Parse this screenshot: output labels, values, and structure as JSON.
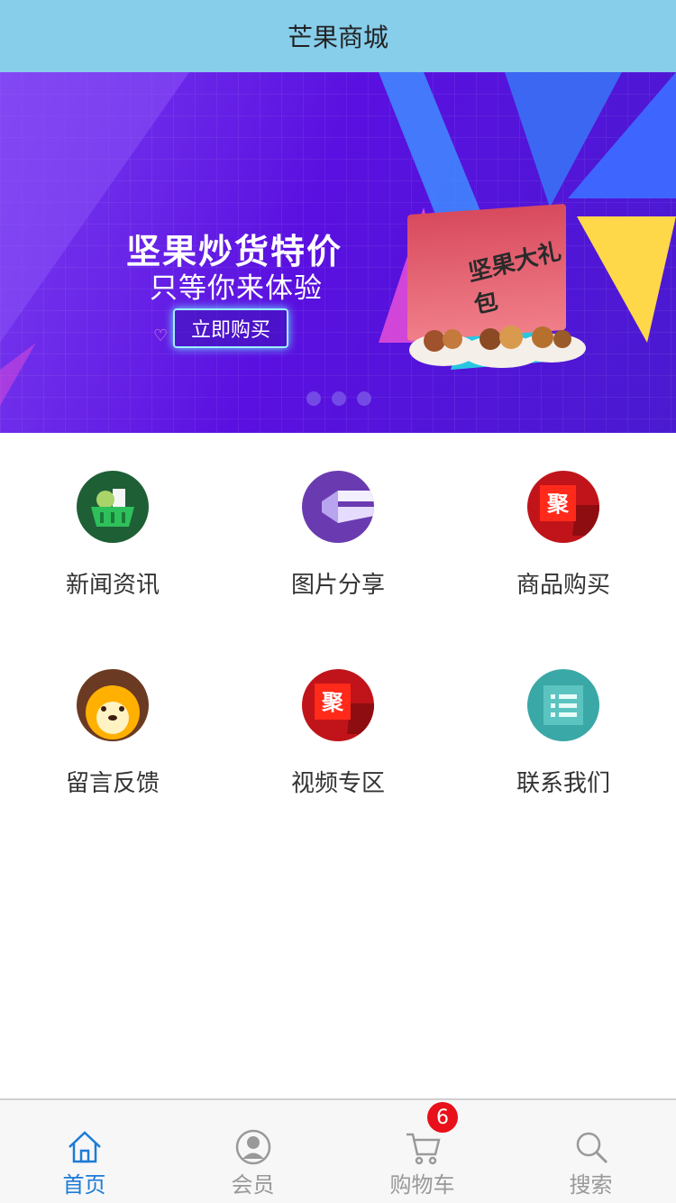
{
  "header": {
    "title": "芒果商城"
  },
  "banner": {
    "headline": "坚果炒货特价",
    "subline": "只等你来体验",
    "button_label": "立即购买",
    "box_label": "坚果大礼包"
  },
  "menu": [
    {
      "label": "新闻资讯",
      "icon": "grocery-basket-icon",
      "color": "#1f6b3a"
    },
    {
      "label": "图片分享",
      "icon": "share-arrow-icon",
      "color": "#6a3bb0"
    },
    {
      "label": "商品购买",
      "icon": "ju-tag-icon",
      "color": "#c0141a"
    },
    {
      "label": "留言反馈",
      "icon": "lion-face-icon",
      "color": "#6b3a22"
    },
    {
      "label": "视频专区",
      "icon": "ju-tag-icon",
      "color": "#c0141a"
    },
    {
      "label": "联系我们",
      "icon": "list-icon",
      "color": "#3aa8a6"
    }
  ],
  "tabbar": {
    "items": [
      {
        "label": "首页",
        "icon": "home-icon"
      },
      {
        "label": "会员",
        "icon": "user-icon"
      },
      {
        "label": "购物车",
        "icon": "cart-icon"
      },
      {
        "label": "搜索",
        "icon": "search-icon"
      }
    ],
    "active": 0,
    "cart_badge": "6"
  }
}
